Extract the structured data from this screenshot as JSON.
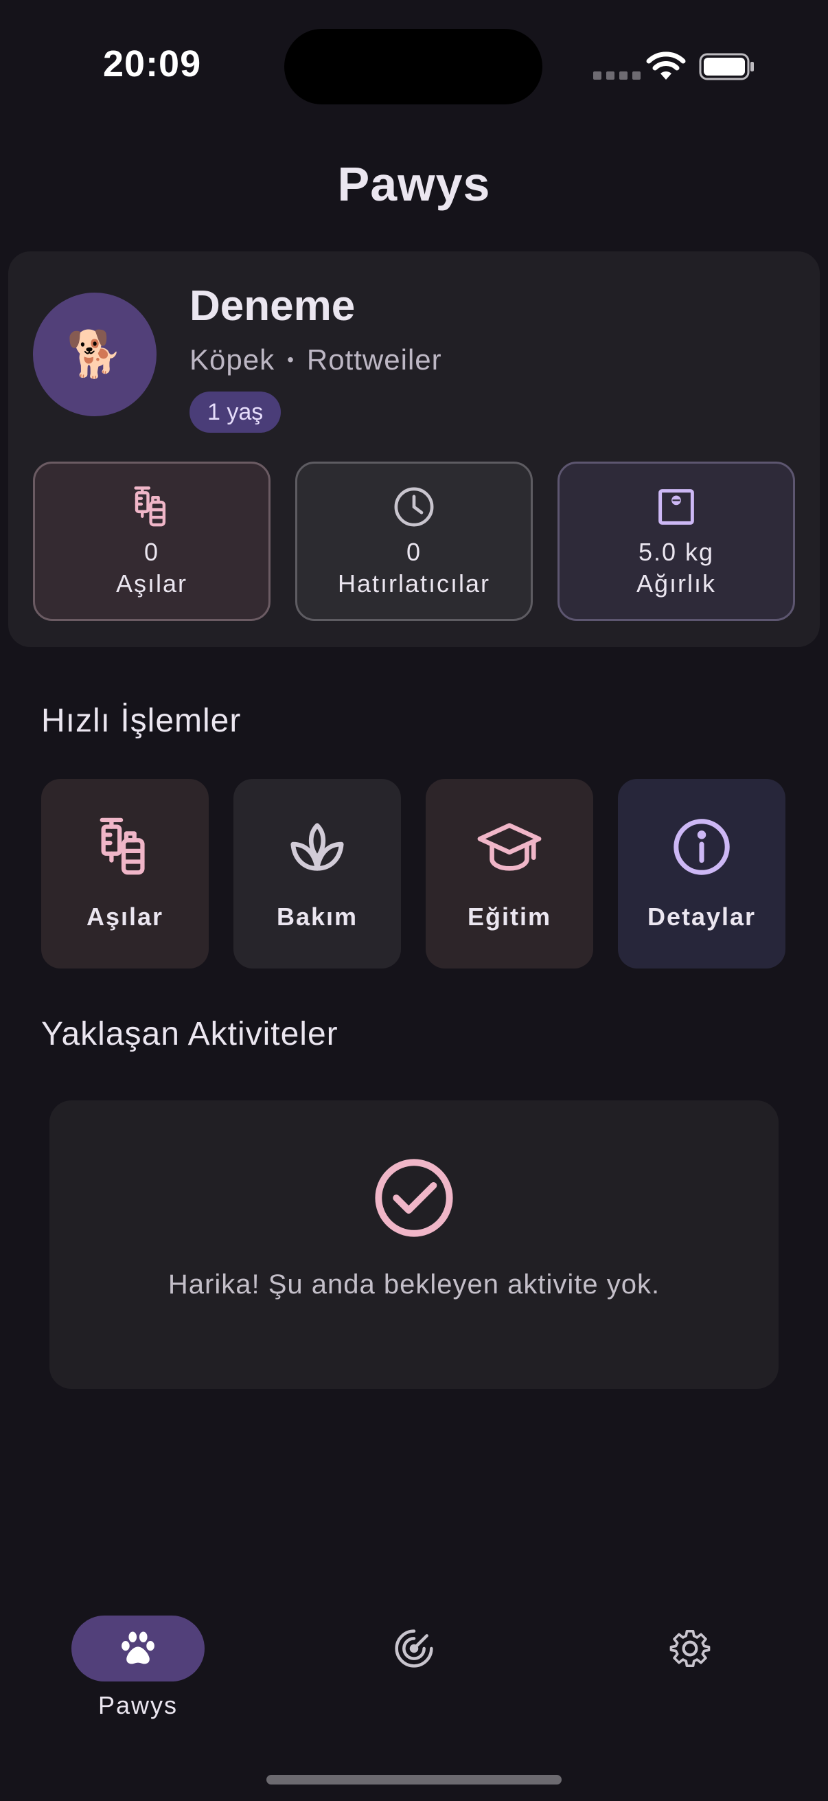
{
  "status": {
    "time": "20:09"
  },
  "app": {
    "title": "Pawys"
  },
  "pet": {
    "avatar_emoji": "🐕",
    "name": "Deneme",
    "species": "Köpek",
    "separator": "•",
    "breed": "Rottweiler",
    "age": "1 yaş"
  },
  "stats": [
    {
      "icon": "syringe-icon",
      "value": "0",
      "label": "Aşılar"
    },
    {
      "icon": "clock-icon",
      "value": "0",
      "label": "Hatırlatıcılar"
    },
    {
      "icon": "scale-icon",
      "value": "5.0 kg",
      "label": "Ağırlık"
    }
  ],
  "quick_actions": {
    "title": "Hızlı İşlemler",
    "items": [
      {
        "icon": "syringe-icon",
        "label": "Aşılar"
      },
      {
        "icon": "spa-icon",
        "label": "Bakım"
      },
      {
        "icon": "graduation-cap-icon",
        "label": "Eğitim"
      },
      {
        "icon": "info-icon",
        "label": "Detaylar"
      }
    ]
  },
  "upcoming": {
    "title": "Yaklaşan Aktiviteler",
    "empty_icon": "check-circle-icon",
    "empty_message": "Harika! Şu anda bekleyen aktivite yok."
  },
  "nav": {
    "items": [
      {
        "icon": "paw-icon",
        "label": "Pawys",
        "active": true
      },
      {
        "icon": "radar-icon",
        "label": ""
      },
      {
        "icon": "gear-icon",
        "label": ""
      }
    ]
  },
  "colors": {
    "background": "#15131a",
    "card": "#211f25",
    "accent_pink": "#f0b6c8",
    "accent_lavender": "#cdb8f5",
    "accent_purple": "#52407a"
  }
}
